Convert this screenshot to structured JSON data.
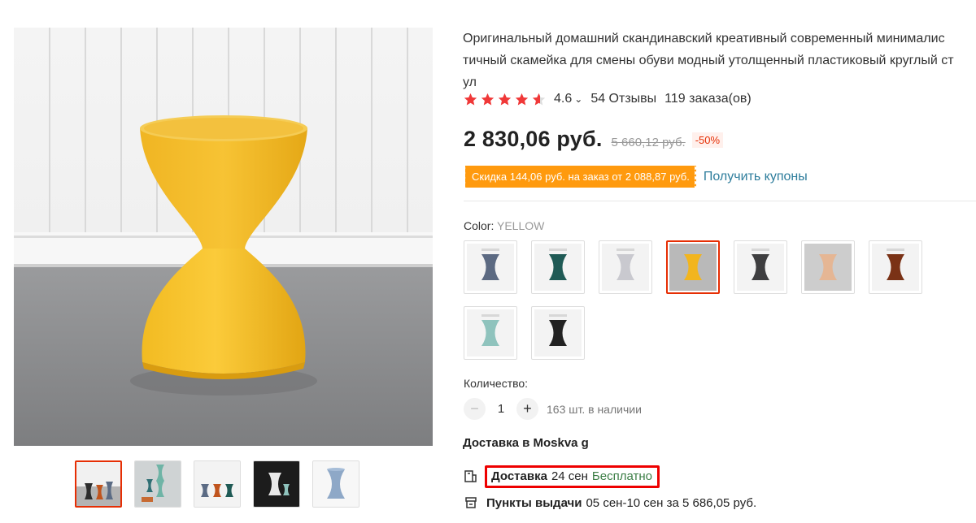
{
  "product": {
    "title": "Оригинальный домашний скандинавский креативный современный минималис\nтичный скамейка для смены обуви модный утолщенный пластиковый круглый ст\nул",
    "rating": "4.6",
    "reviews": "54 Отзывы",
    "orders": "119 заказа(ов)",
    "price": "2 830,06 руб.",
    "old_price": "5 660,12 руб.",
    "discount": "-50%",
    "coupon_badge": "Скидка 144,06 руб. на заказ от 2 088,87 руб.",
    "coupon_link": "Получить купоны",
    "accent_color": "#e62e04",
    "badge_color": "#ff9a0e"
  },
  "color_selector": {
    "label": "Color:",
    "selected": "YELLOW",
    "options": [
      {
        "color": "#5c6a82",
        "icon": "stool-slate-blue"
      },
      {
        "color": "#1f5a55",
        "icon": "stool-dark-green"
      },
      {
        "color": "#c9c9cf",
        "icon": "stool-light-grey"
      },
      {
        "color": "#f2b51e",
        "icon": "stool-yellow"
      },
      {
        "color": "#3e3e40",
        "icon": "stool-dark-grey"
      },
      {
        "color": "#e5b694",
        "icon": "stool-peach"
      },
      {
        "color": "#7a3216",
        "icon": "stool-brown"
      },
      {
        "color": "#8fc3bd",
        "icon": "stool-mint"
      },
      {
        "color": "#222222",
        "icon": "stool-black"
      }
    ]
  },
  "quantity": {
    "label": "Количество:",
    "minus": "−",
    "value": "1",
    "plus": "+",
    "stock": "163 шт. в наличии"
  },
  "delivery": {
    "to_label": "Доставка в Moskva g",
    "label": "Доставка",
    "date": "24 сен",
    "cost": "Бесплатно",
    "pickup_label": "Пункты выдачи",
    "pickup_info": "05 сен-10 сен за 5 686,05 руб."
  },
  "gallery": {
    "thumbs": [
      "thumb-multicolor-stools",
      "thumb-stacked-stools",
      "thumb-three-stools",
      "thumb-dark-scene",
      "thumb-blue-stool"
    ]
  }
}
